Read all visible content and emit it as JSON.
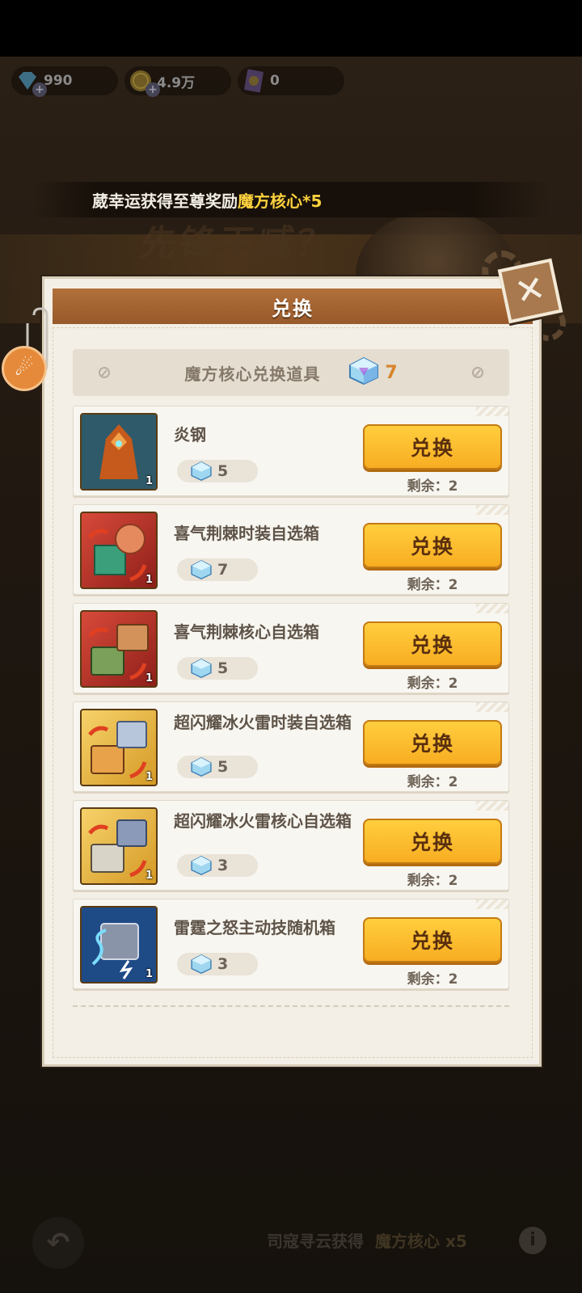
{
  "resources": [
    {
      "icon": "gem-icon",
      "value": "990"
    },
    {
      "icon": "coin-icon",
      "value": "4.9万"
    },
    {
      "icon": "card-icon",
      "value": "0"
    }
  ],
  "toast": {
    "prefix": "葳幸运获得至尊奖励",
    "highlight": "魔方核心*5"
  },
  "background_title": "先锋王臧？",
  "panel": {
    "title": "兑换",
    "subheader": {
      "label": "魔方核心兑换道具",
      "count": "7"
    },
    "items": [
      {
        "name": "炎钢",
        "cost": "5",
        "button": "兑换",
        "remain": "剩余：2",
        "qty": "1"
      },
      {
        "name": "喜气荆棘时装自选箱",
        "cost": "7",
        "button": "兑换",
        "remain": "剩余：2",
        "qty": "1"
      },
      {
        "name": "喜气荆棘核心自选箱",
        "cost": "5",
        "button": "兑换",
        "remain": "剩余：2",
        "qty": "1"
      },
      {
        "name": "超闪耀冰火雷时装自选箱",
        "cost": "5",
        "button": "兑换",
        "remain": "剩余：2",
        "qty": "1"
      },
      {
        "name": "超闪耀冰火雷核心自选箱",
        "cost": "3",
        "button": "兑换",
        "remain": "剩余：2",
        "qty": "1"
      },
      {
        "name": "雷霆之怒主动技随机箱",
        "cost": "3",
        "button": "兑换",
        "remain": "剩余：2",
        "qty": "1"
      }
    ]
  },
  "bottom": {
    "source": "司寇寻云获得",
    "item": "魔方核心 x5",
    "info_icon": "i"
  },
  "colors": {
    "accent": "#ffce3e",
    "header": "#a8663a",
    "highlight": "#ffd23d",
    "count": "#d8832c"
  }
}
